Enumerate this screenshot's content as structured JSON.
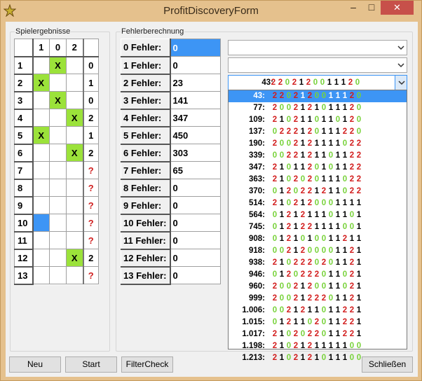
{
  "window": {
    "title": "ProfitDiscoveryForm"
  },
  "titlebar": {
    "min": "–",
    "max": "□",
    "close": "✕"
  },
  "left_group": {
    "caption": "Spielergebnisse",
    "headers": [
      "",
      "1",
      "0",
      "2",
      ""
    ],
    "rows": [
      {
        "n": "1",
        "c1": "",
        "c0": "X",
        "c2": "",
        "r": "0"
      },
      {
        "n": "2",
        "c1": "X",
        "c0": "",
        "c2": "",
        "r": "1"
      },
      {
        "n": "3",
        "c1": "",
        "c0": "X",
        "c2": "",
        "r": "0"
      },
      {
        "n": "4",
        "c1": "",
        "c0": "",
        "c2": "X",
        "r": "2"
      },
      {
        "n": "5",
        "c1": "X",
        "c0": "",
        "c2": "",
        "r": "1"
      },
      {
        "n": "6",
        "c1": "",
        "c0": "",
        "c2": "X",
        "r": "2"
      },
      {
        "n": "7",
        "c1": "",
        "c0": "",
        "c2": "",
        "r": "?"
      },
      {
        "n": "8",
        "c1": "",
        "c0": "",
        "c2": "",
        "r": "?"
      },
      {
        "n": "9",
        "c1": "",
        "c0": "",
        "c2": "",
        "r": "?"
      },
      {
        "n": "10",
        "c1": "",
        "c0": "",
        "c2": "",
        "r": "?"
      },
      {
        "n": "11",
        "c1": "",
        "c0": "",
        "c2": "",
        "r": "?"
      },
      {
        "n": "12",
        "c1": "",
        "c0": "",
        "c2": "X",
        "r": "2"
      },
      {
        "n": "13",
        "c1": "",
        "c0": "",
        "c2": "",
        "r": "?"
      }
    ]
  },
  "right_group": {
    "caption": "Fehlerberechnung",
    "fehler": [
      {
        "label": "0 Fehler:",
        "value": "0"
      },
      {
        "label": "1 Fehler:",
        "value": "0"
      },
      {
        "label": "2 Fehler:",
        "value": "23"
      },
      {
        "label": "3 Fehler:",
        "value": "141"
      },
      {
        "label": "4 Fehler:",
        "value": "347"
      },
      {
        "label": "5 Fehler:",
        "value": "450"
      },
      {
        "label": "6 Fehler:",
        "value": "303"
      },
      {
        "label": "7 Fehler:",
        "value": "65"
      },
      {
        "label": "8 Fehler:",
        "value": "0"
      },
      {
        "label": "9 Fehler:",
        "value": "0"
      },
      {
        "label": "10 Fehler:",
        "value": "0"
      },
      {
        "label": "11 Fehler:",
        "value": "0"
      },
      {
        "label": "12 Fehler:",
        "value": "0"
      },
      {
        "label": "13 Fehler:",
        "value": "0"
      }
    ],
    "combo1": "",
    "combo2": "",
    "combo3": {
      "num": "43:",
      "digits": "2202120011120"
    },
    "list": [
      {
        "num": "43:",
        "digits": "2202120011120"
      },
      {
        "num": "77:",
        "digits": "2002121011120"
      },
      {
        "num": "109:",
        "digits": "2102110110120"
      },
      {
        "num": "137:",
        "digits": "0222120111220"
      },
      {
        "num": "190:",
        "digits": "2002121111022"
      },
      {
        "num": "339:",
        "digits": "0022121101122"
      },
      {
        "num": "347:",
        "digits": "2101120101122"
      },
      {
        "num": "363:",
        "digits": "2102020111022"
      },
      {
        "num": "370:",
        "digits": "0120221211022"
      },
      {
        "num": "514:",
        "digits": "2102120001111"
      },
      {
        "num": "564:",
        "digits": "0121211101101"
      },
      {
        "num": "745:",
        "digits": "0121221111001"
      },
      {
        "num": "908:",
        "digits": "0121010011211"
      },
      {
        "num": "918:",
        "digits": "0021200001121"
      },
      {
        "num": "938:",
        "digits": "2102220201121"
      },
      {
        "num": "946:",
        "digits": "0120222011021"
      },
      {
        "num": "960:",
        "digits": "2002120011021"
      },
      {
        "num": "999:",
        "digits": "2002122201121"
      },
      {
        "num": "1.006:",
        "digits": "0021211011221"
      },
      {
        "num": "1.015:",
        "digits": "0121102011221"
      },
      {
        "num": "1.017:",
        "digits": "2102022011221"
      },
      {
        "num": "1.198:",
        "digits": "2102121111100"
      },
      {
        "num": "1.213:",
        "digits": "2102121011100"
      }
    ]
  },
  "buttons": {
    "neu": "Neu",
    "start": "Start",
    "filter": "FilterCheck",
    "close": "Schließen"
  },
  "colors": {
    "digit0": "#78d23a",
    "digit1": "#000000",
    "digit2": "#d21c1c",
    "selection": "#3d95f5",
    "hit": "#9be23a"
  }
}
